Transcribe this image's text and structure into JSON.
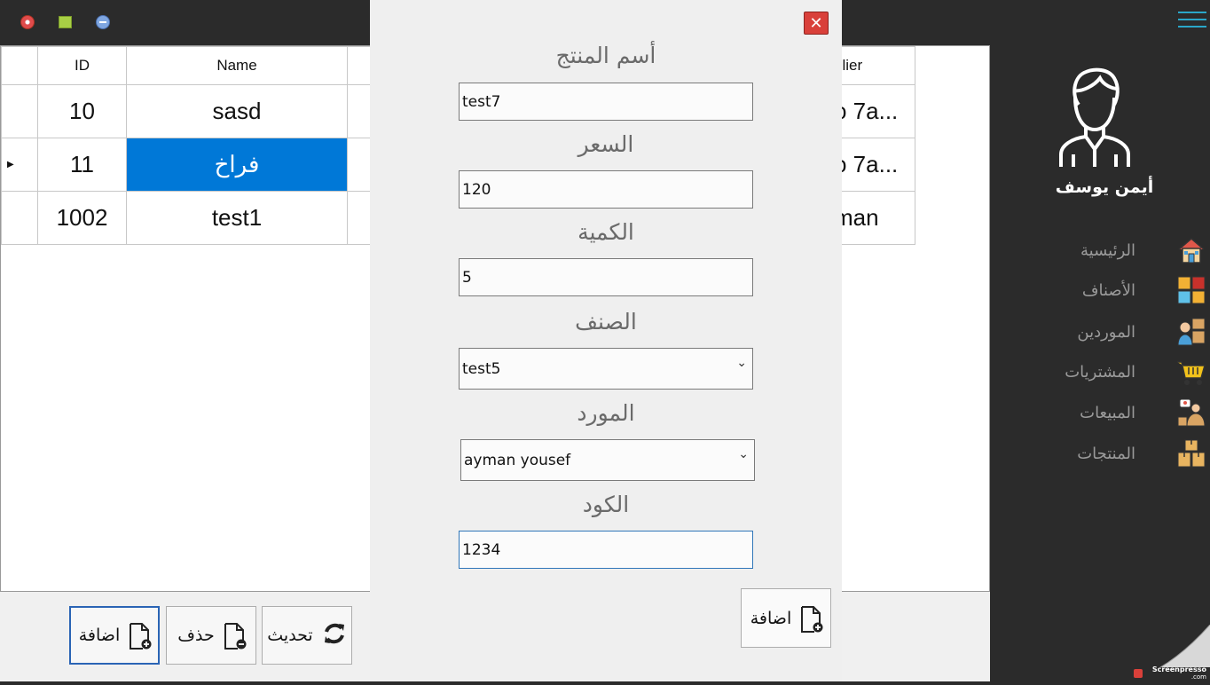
{
  "grid": {
    "columns": [
      "ID",
      "Name",
      "plier"
    ],
    "rows": [
      {
        "id": "10",
        "name": "sasd",
        "supplier": "o 7a..."
      },
      {
        "id": "11",
        "name": "فراخ",
        "supplier": "o 7a..."
      },
      {
        "id": "1002",
        "name": "test1",
        "supplier": "man"
      }
    ],
    "selected_row": 1
  },
  "bottom_buttons": {
    "add": "اضافة",
    "delete": "حذف",
    "refresh": "تحديث"
  },
  "sidebar": {
    "username": "أيمن يوسف",
    "items": [
      {
        "label": "الرئيسية",
        "icon": "home-icon"
      },
      {
        "label": "الأصناف",
        "icon": "categories-icon"
      },
      {
        "label": "الموردين",
        "icon": "suppliers-icon"
      },
      {
        "label": "المشتريات",
        "icon": "cart-icon"
      },
      {
        "label": "المبيعات",
        "icon": "sales-icon"
      },
      {
        "label": "المنتجات",
        "icon": "products-icon"
      }
    ]
  },
  "dialog": {
    "fields": {
      "name_label": "أسم المنتج",
      "name_value": "test7",
      "price_label": "السعر",
      "price_value": "120",
      "qty_label": "الكمية",
      "qty_value": "5",
      "category_label": "الصنف",
      "category_value": "test5",
      "supplier_label": "المورد",
      "supplier_value": "ayman yousef",
      "code_label": "الكود",
      "code_value": "1234"
    },
    "add_label": "اضافة"
  },
  "watermark": "Screenpresso",
  "watermark_sub": ".com",
  "colors": {
    "selection": "#0078d7",
    "accent": "#2aa7c9",
    "close": "#d9403a"
  }
}
